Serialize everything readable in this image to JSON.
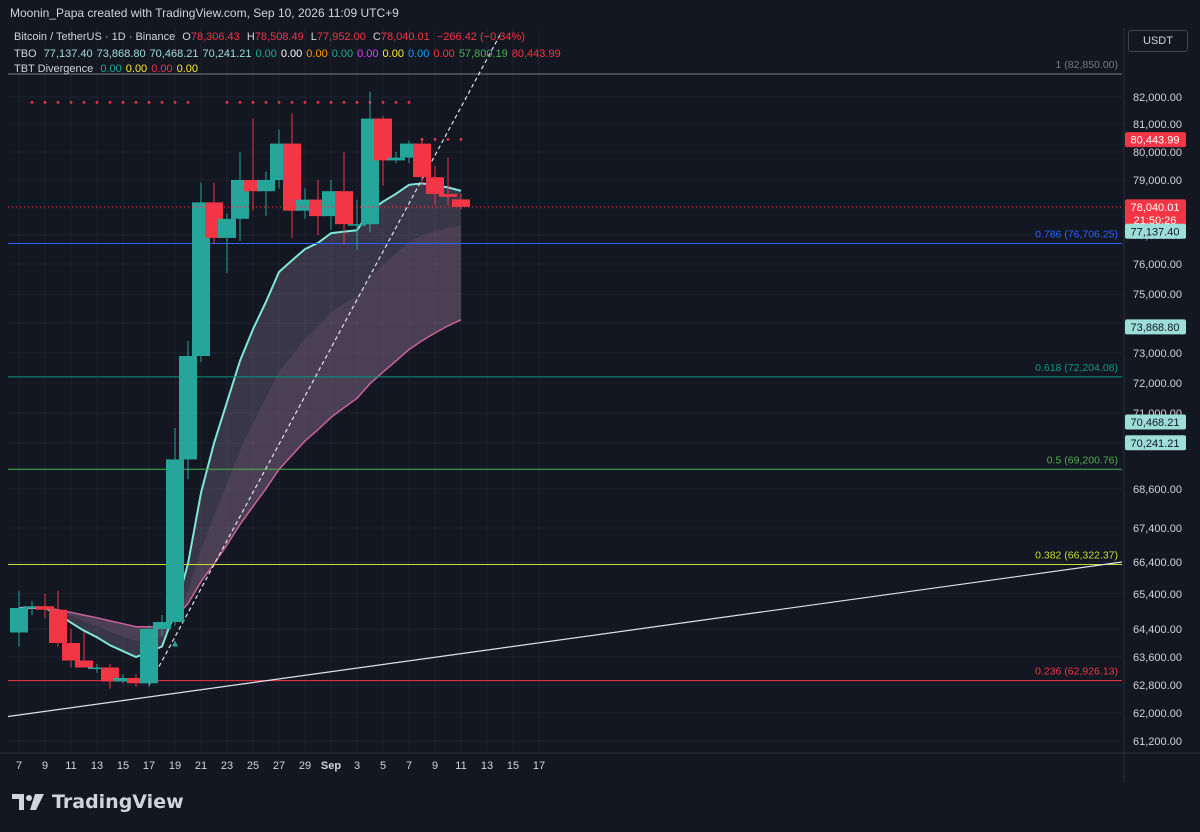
{
  "header": {
    "credit": "Moonin_Papa created with TradingView.com, Sep 10, 2026 11:09 UTC+9",
    "symbol": "Bitcoin / TetherUS · 1D · Binance",
    "ohlc": {
      "o_label": "O",
      "o": "78,306.43",
      "h_label": "H",
      "h": "78,508.49",
      "l_label": "L",
      "l": "77,952.00",
      "c_label": "C",
      "c": "78,040.01",
      "change": "−266.42 (−0.34%)"
    },
    "tbo": {
      "label": "TBO",
      "values": [
        {
          "v": "77,137.40",
          "color": "#9eded9"
        },
        {
          "v": "73,868.80",
          "color": "#9eded9"
        },
        {
          "v": "70,468.21",
          "color": "#9eded9"
        },
        {
          "v": "70,241.21",
          "color": "#9eded9"
        },
        {
          "v": "0.00",
          "color": "#22ab94"
        },
        {
          "v": "0.00",
          "color": "#ffffff"
        },
        {
          "v": "0.00",
          "color": "#ff9800"
        },
        {
          "v": "0.00",
          "color": "#22ab94"
        },
        {
          "v": "0.00",
          "color": "#e040fb"
        },
        {
          "v": "0.00",
          "color": "#ffeb3b"
        },
        {
          "v": "0.00",
          "color": "#2196f3"
        },
        {
          "v": "0.00",
          "color": "#f23645"
        },
        {
          "v": "57,800.19",
          "color": "#4caf50"
        },
        {
          "v": "80,443.99",
          "color": "#f23645"
        }
      ]
    },
    "tbt": {
      "label": "TBT Divergence",
      "values": [
        {
          "v": "0.00",
          "color": "#22ab94"
        },
        {
          "v": "0.00",
          "color": "#ffeb3b"
        },
        {
          "v": "0.00",
          "color": "#f23645"
        },
        {
          "v": "0.00",
          "color": "#ffeb3b"
        }
      ]
    }
  },
  "currency": "USDT",
  "brand": "TradingView",
  "chart_data": {
    "type": "candlestick",
    "x_tick_labels": [
      "7",
      "9",
      "11",
      "13",
      "15",
      "17",
      "19",
      "21",
      "23",
      "25",
      "27",
      "29",
      "Sep",
      "3",
      "5",
      "7",
      "9",
      "11",
      "13",
      "15",
      "17"
    ],
    "y_ticks": [
      61200,
      62000,
      62800,
      63600,
      64400,
      65400,
      66400,
      67400,
      68600,
      70000,
      71000,
      72000,
      73000,
      74000,
      75000,
      76000,
      77000,
      78000,
      79000,
      80000,
      81000,
      82000
    ],
    "candles": [
      {
        "d": "Aug 7",
        "o": 64300,
        "h": 65500,
        "l": 63900,
        "c": 65000
      },
      {
        "d": "Aug 8",
        "o": 65000,
        "h": 65200,
        "l": 64800,
        "c": 65050
      },
      {
        "d": "Aug 9",
        "o": 65050,
        "h": 65400,
        "l": 64700,
        "c": 64950
      },
      {
        "d": "Aug 10",
        "o": 64950,
        "h": 65500,
        "l": 63900,
        "c": 64000
      },
      {
        "d": "Aug 11",
        "o": 64000,
        "h": 64400,
        "l": 63300,
        "c": 63500
      },
      {
        "d": "Aug 12",
        "o": 63500,
        "h": 64300,
        "l": 63300,
        "c": 63300
      },
      {
        "d": "Aug 13",
        "o": 63300,
        "h": 63400,
        "l": 63150,
        "c": 63300
      },
      {
        "d": "Aug 14",
        "o": 63300,
        "h": 63400,
        "l": 62700,
        "c": 62900
      },
      {
        "d": "Aug 15",
        "o": 62900,
        "h": 63100,
        "l": 62850,
        "c": 63000
      },
      {
        "d": "Aug 16",
        "o": 63000,
        "h": 63100,
        "l": 62750,
        "c": 62850
      },
      {
        "d": "Aug 17",
        "o": 62850,
        "h": 64500,
        "l": 62750,
        "c": 64400
      },
      {
        "d": "Aug 18",
        "o": 64400,
        "h": 64800,
        "l": 64200,
        "c": 64600
      },
      {
        "d": "Aug 19",
        "o": 64600,
        "h": 70500,
        "l": 64500,
        "c": 69500
      },
      {
        "d": "Aug 20",
        "o": 69500,
        "h": 73400,
        "l": 68900,
        "c": 72900
      },
      {
        "d": "Aug 21",
        "o": 72900,
        "h": 78900,
        "l": 72700,
        "c": 78200
      },
      {
        "d": "Aug 22",
        "o": 78200,
        "h": 78900,
        "l": 76700,
        "c": 76900
      },
      {
        "d": "Aug 23",
        "o": 76900,
        "h": 77800,
        "l": 75700,
        "c": 77600
      },
      {
        "d": "Aug 24",
        "o": 77600,
        "h": 80000,
        "l": 76800,
        "c": 79000
      },
      {
        "d": "Aug 25",
        "o": 79000,
        "h": 81200,
        "l": 77900,
        "c": 78600
      },
      {
        "d": "Aug 26",
        "o": 78600,
        "h": 79300,
        "l": 77700,
        "c": 79000
      },
      {
        "d": "Aug 27",
        "o": 79000,
        "h": 80800,
        "l": 78700,
        "c": 80300
      },
      {
        "d": "Aug 28",
        "o": 80300,
        "h": 81400,
        "l": 76900,
        "c": 77900
      },
      {
        "d": "Aug 29",
        "o": 77900,
        "h": 78700,
        "l": 77600,
        "c": 78300
      },
      {
        "d": "Aug 30",
        "o": 78300,
        "h": 79000,
        "l": 77000,
        "c": 77700
      },
      {
        "d": "Aug 31",
        "o": 77700,
        "h": 79000,
        "l": 77200,
        "c": 78600
      },
      {
        "d": "Sep 1",
        "o": 78600,
        "h": 80000,
        "l": 76700,
        "c": 77400
      },
      {
        "d": "Sep 2",
        "o": 77400,
        "h": 78300,
        "l": 76500,
        "c": 77400
      },
      {
        "d": "Sep 3",
        "o": 77400,
        "h": 82200,
        "l": 77100,
        "c": 81200
      },
      {
        "d": "Sep 4",
        "o": 81200,
        "h": 81300,
        "l": 78800,
        "c": 79700
      },
      {
        "d": "Sep 5",
        "o": 79700,
        "h": 80000,
        "l": 79600,
        "c": 79800
      },
      {
        "d": "Sep 6",
        "o": 79800,
        "h": 80400,
        "l": 79600,
        "c": 80300
      },
      {
        "d": "Sep 7",
        "o": 80300,
        "h": 80500,
        "l": 78800,
        "c": 79100
      },
      {
        "d": "Sep 8",
        "o": 79100,
        "h": 79500,
        "l": 78100,
        "c": 78500
      },
      {
        "d": "Sep 9",
        "o": 78500,
        "h": 79800,
        "l": 78100,
        "c": 78400
      },
      {
        "d": "Sep 10",
        "o": 78306.43,
        "h": 78508.49,
        "l": 77952,
        "c": 78040.01
      }
    ],
    "fib_levels": [
      {
        "label": "1 (82,850.00)",
        "price": 82850,
        "color": "#787b86"
      },
      {
        "label": "0.786 (76,706.25)",
        "price": 76706.25,
        "color": "#2962ff"
      },
      {
        "label": "0.618 (72,204.08)",
        "price": 72204.08,
        "color": "#089981"
      },
      {
        "label": "0.5 (69,200.76)",
        "price": 69200.76,
        "color": "#4caf50"
      },
      {
        "label": "0.382 (66,322.37)",
        "price": 66322.37,
        "color": "#cddc39"
      },
      {
        "label": "0.236 (62,926.13)",
        "price": 62926.13,
        "color": "#f23645"
      }
    ],
    "price_tags": [
      {
        "label": "80,443.99",
        "price": 80443.99,
        "color": "#f23645"
      },
      {
        "label": "78,040.01",
        "price": 78040.01,
        "color": "#f23645",
        "countdown": "21:50:26"
      },
      {
        "label": "77,137.40",
        "price": 77137.4,
        "color": "#9eded9"
      },
      {
        "label": "73,868.80",
        "price": 73868.8,
        "color": "#9eded9"
      },
      {
        "label": "70,468.21",
        "price": 70468.21,
        "color": "#9eded9"
      },
      {
        "label": "70,241.21",
        "price": 70241.21,
        "color": "#9eded9"
      }
    ],
    "colors": {
      "up": "#26a69a",
      "down": "#f23645",
      "bg": "#131722",
      "grid": "#1e222d",
      "text": "#d1d4dc",
      "fast_line": "#7ee8d8",
      "slow_line": "#f06fb4"
    }
  }
}
